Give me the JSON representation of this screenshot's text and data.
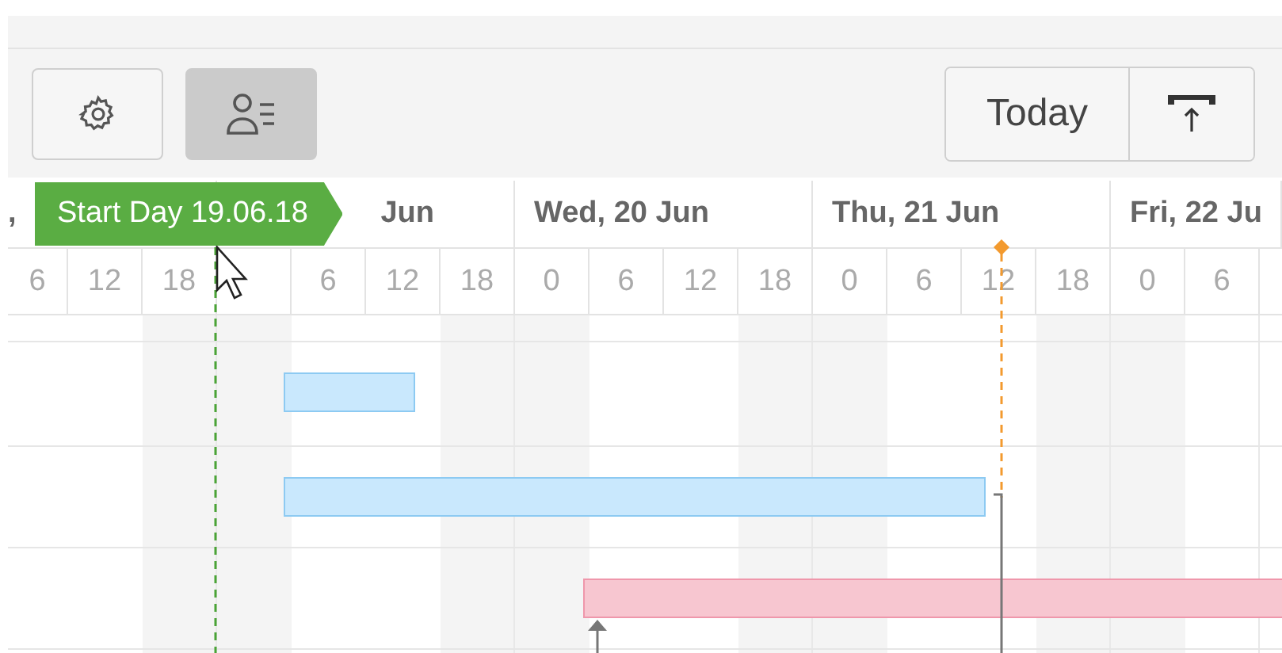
{
  "toolbar": {
    "settings_button": {
      "selected": false
    },
    "resource_button": {
      "selected": true
    },
    "today_button": {
      "label": "Today"
    },
    "scroll_button": {
      "selected": false
    }
  },
  "days": [
    {
      "label": ",",
      "hours": [
        "6",
        "12",
        "18"
      ]
    },
    {
      "label": "Jun",
      "hours": [
        "6",
        "12",
        "18"
      ]
    },
    {
      "label": "Wed, 20 Jun",
      "hours": [
        "0",
        "6",
        "12",
        "18"
      ]
    },
    {
      "label": "Thu, 21 Jun",
      "hours": [
        "0",
        "6",
        "12",
        "18"
      ]
    },
    {
      "label": "Fri, 22 Ju",
      "hours": [
        "0",
        "6"
      ]
    }
  ],
  "start_marker": {
    "label": "Start Day 19.06.18"
  },
  "bars": [
    {
      "kind": "task",
      "color": "#c9e8fd"
    },
    {
      "kind": "task",
      "color": "#c9e8fd"
    },
    {
      "kind": "task",
      "color": "#f7c6d0"
    }
  ]
}
